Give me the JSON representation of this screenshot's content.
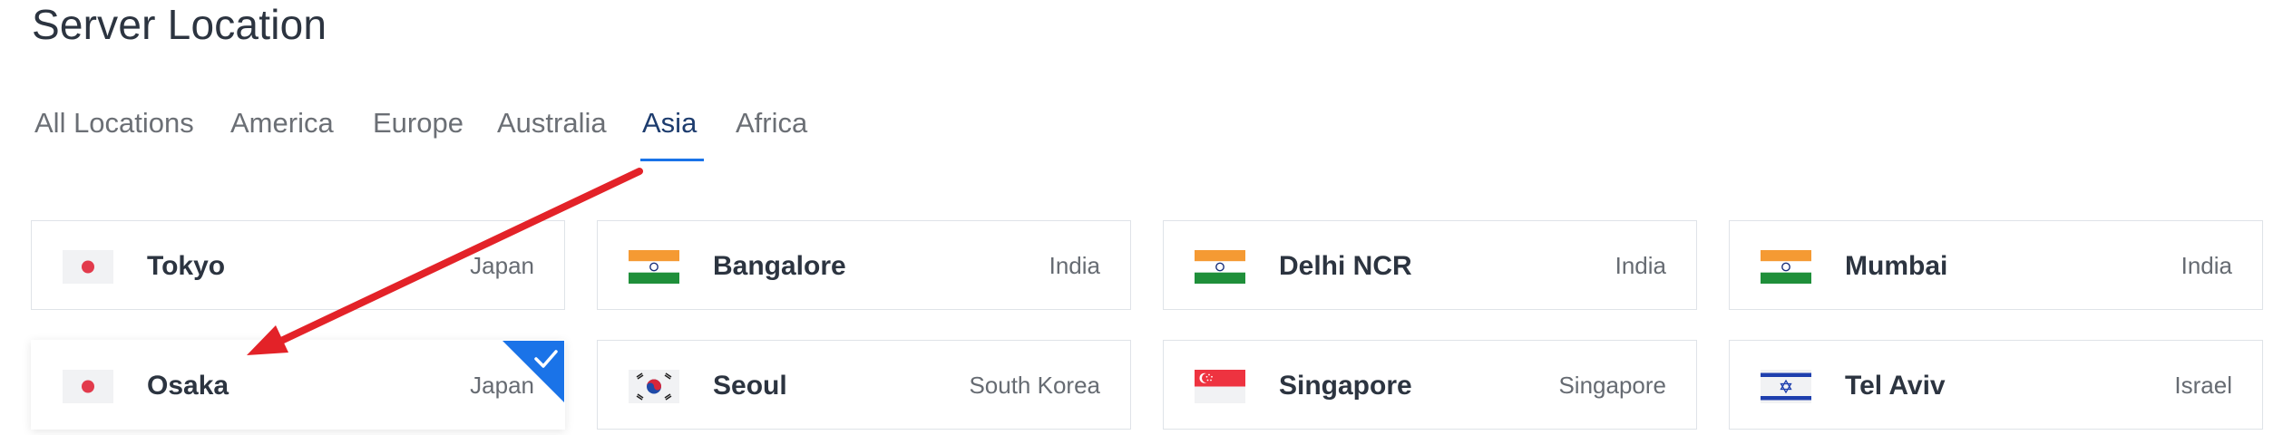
{
  "page": {
    "title": "Server Location"
  },
  "tabs": [
    {
      "label": "All Locations"
    },
    {
      "label": "America"
    },
    {
      "label": "Europe"
    },
    {
      "label": "Australia"
    },
    {
      "label": "Asia",
      "active": true
    },
    {
      "label": "Africa"
    }
  ],
  "locations": [
    {
      "city": "Tokyo",
      "country": "Japan",
      "flag": "japan-flag"
    },
    {
      "city": "Bangalore",
      "country": "India",
      "flag": "india-flag"
    },
    {
      "city": "Delhi NCR",
      "country": "India",
      "flag": "india-flag"
    },
    {
      "city": "Mumbai",
      "country": "India",
      "flag": "india-flag"
    },
    {
      "city": "Osaka",
      "country": "Japan",
      "flag": "japan-flag",
      "selected": true
    },
    {
      "city": "Seoul",
      "country": "South Korea",
      "flag": "south-korea-flag"
    },
    {
      "city": "Singapore",
      "country": "Singapore",
      "flag": "singapore-flag"
    },
    {
      "city": "Tel Aviv",
      "country": "Israel",
      "flag": "israel-flag"
    }
  ],
  "colors": {
    "accent": "#1a73e8",
    "annotation_arrow": "#e32228",
    "title_text": "#2c3440"
  }
}
